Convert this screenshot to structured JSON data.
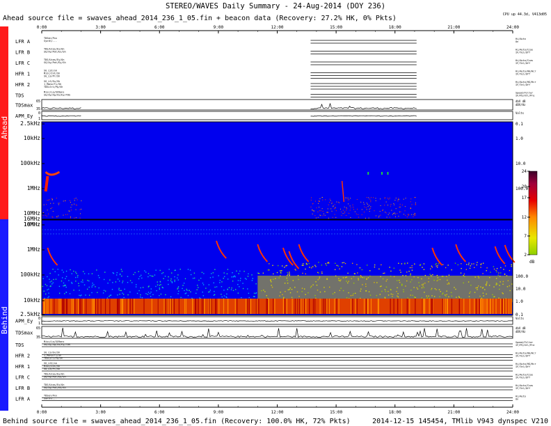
{
  "header": {
    "title": "STEREO/WAVES Daily Summary - 24-Aug-2014 (DOY 236)",
    "ahead_source": "Ahead source file = swaves_ahead_2014_236_1_05.fin + beacon data (Recovery: 27.2% HK,   0% Pkts)",
    "cpu_note": "CPU up 44.3d, V413d05"
  },
  "footer": {
    "behind_source": "Behind source file = swaves_ahead_2014_236_1_05.fin (Recovery: 100.0% HK,  72% Pkts)",
    "stamp": "2014-12-15 145454, TMlib V943 dynspec V210"
  },
  "side_labels": {
    "ahead": "Ahead",
    "behind": "Behind",
    "ahead_color": "#ff1a1a",
    "behind_color": "#1a1aff"
  },
  "time_axis": {
    "ticks": [
      "0:00",
      "3:00",
      "6:00",
      "9:00",
      "12:00",
      "15:00",
      "18:00",
      "21:00",
      "24:00"
    ]
  },
  "ahead_strips": [
    {
      "label": "LFR A",
      "mid": "TDSen/Pxx\nSynth/...",
      "right": "Hi/Auto\nOn"
    },
    {
      "label": "LFR B",
      "mid": "TDS/Ucas/Ex/On\nSG/Xy/Pot/Ex/Sh",
      "right": "Hi/Auto/Ccas\nIF/Tel/Off"
    },
    {
      "label": "LFR C",
      "mid": "TDS/Ucas/Ey/On\nSG/Xy/Pot/Ey/Sh",
      "right": "Hi/Auto/Ccas\nIF/Tel/Off"
    },
    {
      "label": "HFR 1",
      "mid": "SG_LSI/sk\nMisc/Int/Sh\nSG_LS/Pr/Sh",
      "right": "Hi/Auto/HG/Hcr\nIF/Tel/Off"
    },
    {
      "label": "HFR 2",
      "mid": "SG_LS/Ex/Sh\n1_Mono/Ti/Sh\nTDSLSrc/Pp/Sh",
      "right": "Hi/Auto/HG/Hcr\nIF/Tel/Off"
    },
    {
      "label": "TDS",
      "mid": "Misc/Lo/XX9ans\nSG/Xy/Xp/Xx/Ey/TDS",
      "right": "Speed/Filter\nIF/PS/Xtl/Pre"
    }
  ],
  "behind_strips": [
    {
      "label": "TDS",
      "mid": "Misc/Lo/XX9ans\nSG/Xy/Xp/Xx/Ey/TDS",
      "right": "Speed/Filter\nIF/PS/Xtl/Pre"
    },
    {
      "label": "HFR 2",
      "mid": "SG_LS/Ex/Sh\n1_Mono/Ti/Sh\nTDSLSrc/Pp/Sh",
      "right": "Hi/Auto/HG/Hcr\nIF/Tel/Off"
    },
    {
      "label": "HFR 1",
      "mid": "SG_LSI/sk\nMisc/Int/Sh\nSG_LS/Pr/Sh",
      "right": "Hi/Auto/HG/Hcr\nIF/Tel/Off"
    },
    {
      "label": "LFR C",
      "mid": "TDS/Ucas/Ey/On\nSG/Xy/Pot/Ey/Sh",
      "right": "Hi/Auto/Ccas\nIF/Tel/Off"
    },
    {
      "label": "LFR B",
      "mid": "TDS/Ucas/Ex/On\nSG/Xy/Pot/Ex/Sh",
      "right": "Hi/Auto/Ccas\nIF/Tel/Off"
    },
    {
      "label": "LFR A",
      "mid": "TDSen/Pxx\nSynth/...",
      "right": "Hi/Auto\nOn"
    }
  ],
  "small_panels": {
    "ahead_tdsmax": {
      "label": "TDSmax",
      "y1": "65",
      "y2": "35",
      "right": "dbV dB\ndBV/Hz"
    },
    "ahead_apm": {
      "label": "APM_Ey",
      "y1": "0",
      "y2": "1",
      "right": "Volts"
    },
    "behind_apm": {
      "label": "APM_Ey",
      "y1": "0",
      "y2": "1",
      "right": "Volts"
    },
    "behind_tdsmax": {
      "label": "TDSmax",
      "y1": "65",
      "y2": "35",
      "right": "dbV dB\ndBV/Hz"
    }
  },
  "spectrogram_axes": {
    "ahead_left": [
      "2.5kHz",
      "10kHz",
      "100kHz",
      "1MHz",
      "10MHz",
      "16MHz"
    ],
    "ahead_right": [
      "0.1",
      "1.0",
      "10.0",
      "100.0"
    ],
    "behind_left": [
      "16MHz",
      "10MHz",
      "1MHz",
      "100kHz",
      "10kHz",
      "2.5kHz"
    ],
    "behind_right": [
      "100.0",
      "10.0",
      "1.0",
      "0.1"
    ]
  },
  "colorbar": {
    "ticks": [
      "24",
      "20",
      "17",
      "12",
      "7",
      "2"
    ],
    "unit": "dB",
    "range": [
      2,
      24
    ]
  },
  "chart_data": {
    "type": "heatmap",
    "title": "STEREO/WAVES Daily Summary - 24-Aug-2014 (DOY 236)",
    "x_range": [
      "0:00",
      "24:00"
    ],
    "ahead_coverage_hours": [
      [
        0,
        2
      ],
      [
        13.7,
        19.1
      ]
    ],
    "behind_coverage_hours": [
      [
        0,
        24
      ]
    ],
    "frequency_range": [
      "2.5kHz",
      "16MHz"
    ],
    "colorbar_db": [
      2,
      24
    ]
  }
}
